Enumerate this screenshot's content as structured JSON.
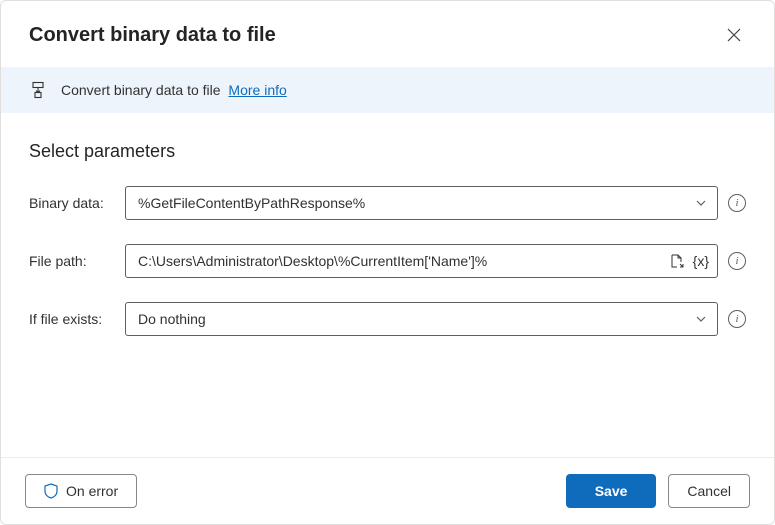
{
  "header": {
    "title": "Convert binary data to file"
  },
  "info_bar": {
    "text": "Convert binary data to file",
    "more_info_label": "More info"
  },
  "section": {
    "title": "Select parameters"
  },
  "fields": {
    "binary_data": {
      "label": "Binary data:",
      "value": "%GetFileContentByPathResponse%"
    },
    "file_path": {
      "label": "File path:",
      "value": "C:\\Users\\Administrator\\Desktop\\%CurrentItem['Name']%"
    },
    "if_file_exists": {
      "label": "If file exists:",
      "value": "Do nothing"
    }
  },
  "footer": {
    "on_error_label": "On error",
    "save_label": "Save",
    "cancel_label": "Cancel"
  }
}
